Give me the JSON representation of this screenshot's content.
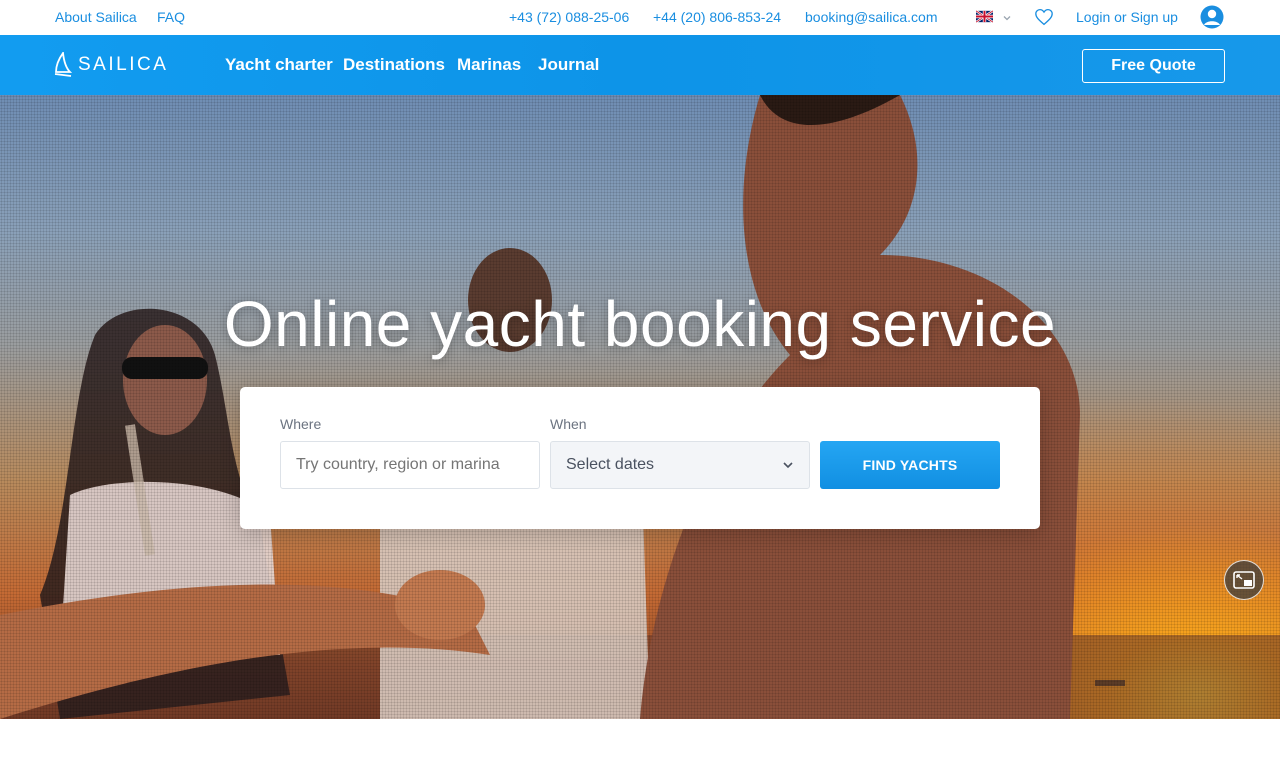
{
  "topbar": {
    "about": "About Sailica",
    "faq": "FAQ",
    "phone1": "+43 (72) 088-25-06",
    "phone2": "+44 (20) 806-853-24",
    "email": "booking@sailica.com",
    "login": "Login or Sign up"
  },
  "nav": {
    "logo": "SAILICA",
    "links": [
      "Yacht charter",
      "Destinations",
      "Marinas",
      "Journal"
    ],
    "quote": "Free Quote"
  },
  "hero": {
    "title": "Online yacht booking service"
  },
  "search": {
    "where_label": "Where",
    "where_placeholder": "Try country, region or marina",
    "when_label": "When",
    "when_value": "Select dates",
    "button": "FIND YACHTS"
  },
  "colors": {
    "brand_blue": "#0d94e8",
    "link_blue": "#1a8ee0"
  }
}
